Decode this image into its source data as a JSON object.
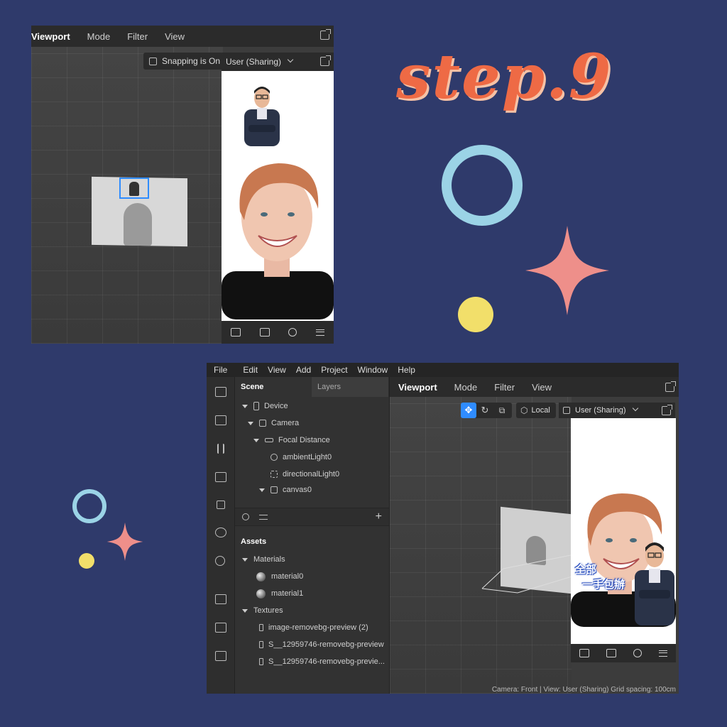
{
  "step_title": "step.9",
  "top_viewport": {
    "tabs": [
      "Viewport",
      "Mode",
      "Filter",
      "View"
    ],
    "snapping_label": "Snapping is On",
    "camera_select": "User (Sharing)"
  },
  "editor": {
    "menu": [
      "File",
      "Edit",
      "View",
      "Add",
      "Project",
      "Window",
      "Help"
    ],
    "scene_tab": "Scene",
    "layers_tab": "Layers",
    "tree": [
      {
        "label": "Device"
      },
      {
        "label": "Camera"
      },
      {
        "label": "Focal Distance"
      },
      {
        "label": "ambientLight0"
      },
      {
        "label": "directionalLight0"
      },
      {
        "label": "canvas0"
      }
    ],
    "assets_title": "Assets",
    "materials_label": "Materials",
    "materials": [
      "material0",
      "material1"
    ],
    "textures_label": "Textures",
    "textures": [
      "image-removebg-preview (2)",
      "S__12959746-removebg-preview",
      "S__12959746-removebg-previe..."
    ],
    "viewport_tabs": [
      "Viewport",
      "Mode",
      "Filter",
      "View"
    ],
    "local_label": "Local",
    "camera_select": "User (Sharing)",
    "sticker_line1": "全部",
    "sticker_line2": "一手包辦",
    "status_bar": "Camera: Front | View: User (Sharing) Grid spacing: 100cm"
  },
  "colors": {
    "background": "#2f3a6b",
    "title": "#ee6a45",
    "ring": "#9bd3e6",
    "star": "#ee8f8a",
    "dot": "#f2df6a",
    "selection": "#2f8cff"
  }
}
